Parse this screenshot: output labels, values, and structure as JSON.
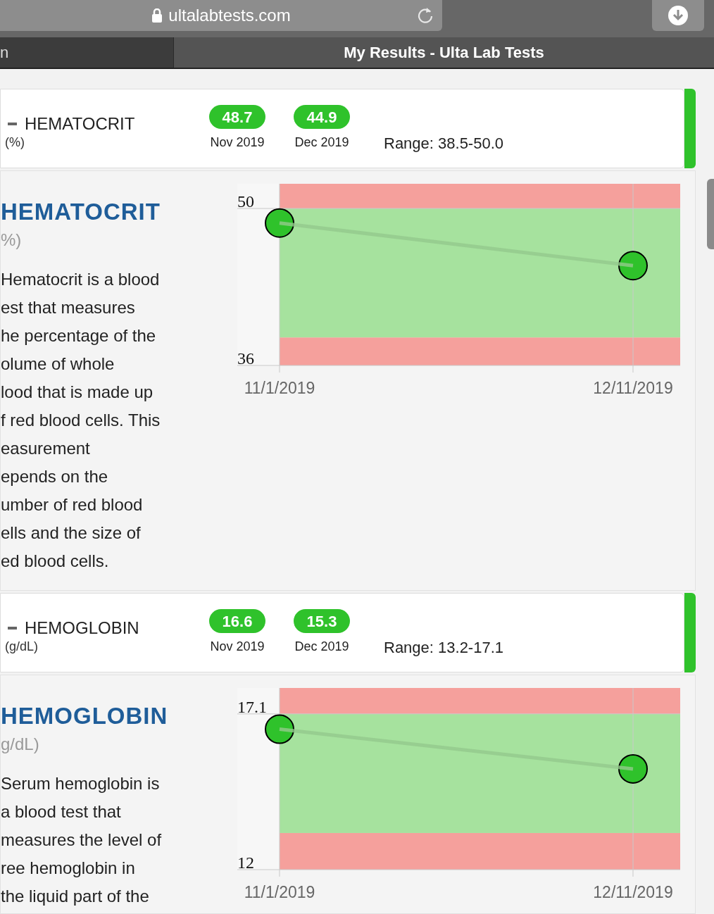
{
  "browser": {
    "url": "ultalabtests.com"
  },
  "tabs": [
    {
      "label": "n",
      "selected": false
    },
    {
      "label": "My Results - Ulta Lab Tests",
      "selected": true
    }
  ],
  "tests": [
    {
      "name": "HEMATOCRIT",
      "unit": "(%)",
      "results": [
        {
          "value": "48.7",
          "date": "Nov 2019"
        },
        {
          "value": "44.9",
          "date": "Dec 2019"
        }
      ],
      "range": "Range: 38.5-50.0",
      "detail": {
        "title": "HEMATOCRIT",
        "unit": "%)",
        "description_lines": [
          "Hematocrit is a blood",
          "est that measures",
          "he percentage of the",
          "olume of whole",
          "lood that is made up",
          "f red blood cells. This",
          "easurement",
          "epends on the",
          "umber of red blood",
          "ells and the size of",
          "ed blood cells."
        ],
        "chart_data": {
          "type": "line",
          "categories": [
            "11/1/2019",
            "12/11/2019"
          ],
          "series": [
            {
              "color": "#2fc22b",
              "marker": "circle",
              "values": [
                48.7,
                44.9
              ]
            }
          ],
          "ylim": [
            36,
            52.2
          ],
          "yticks": [
            36,
            50
          ],
          "grid": true,
          "bands": [
            {
              "axis": "y",
              "from": 36,
              "to": 38.5,
              "color": "#f5a09c"
            },
            {
              "axis": "y",
              "from": 38.5,
              "to": 50,
              "color": "#a6e29e"
            },
            {
              "axis": "y",
              "from": 50,
              "to": 52.2,
              "color": "#f5a09c"
            }
          ]
        }
      }
    },
    {
      "name": "HEMOGLOBIN",
      "unit": "(g/dL)",
      "results": [
        {
          "value": "16.6",
          "date": "Nov 2019"
        },
        {
          "value": "15.3",
          "date": "Dec 2019"
        }
      ],
      "range": "Range: 13.2-17.1",
      "detail": {
        "title": "HEMOGLOBIN",
        "unit": "g/dL)",
        "description_lines": [
          "Serum hemoglobin is",
          "a blood test that",
          "measures the level of",
          "ree hemoglobin in",
          "the liquid part of the"
        ],
        "chart_data": {
          "type": "line",
          "categories": [
            "11/1/2019",
            "12/11/2019"
          ],
          "series": [
            {
              "color": "#2fc22b",
              "marker": "circle",
              "values": [
                16.6,
                15.3
              ]
            }
          ],
          "ylim": [
            12,
            17.95
          ],
          "yticks": [
            12,
            17.1
          ],
          "grid": true,
          "bands": [
            {
              "axis": "y",
              "from": 12,
              "to": 13.2,
              "color": "#f5a09c"
            },
            {
              "axis": "y",
              "from": 13.2,
              "to": 17.1,
              "color": "#a6e29e"
            },
            {
              "axis": "y",
              "from": 17.1,
              "to": 17.95,
              "color": "#f5a09c"
            }
          ]
        }
      }
    }
  ]
}
